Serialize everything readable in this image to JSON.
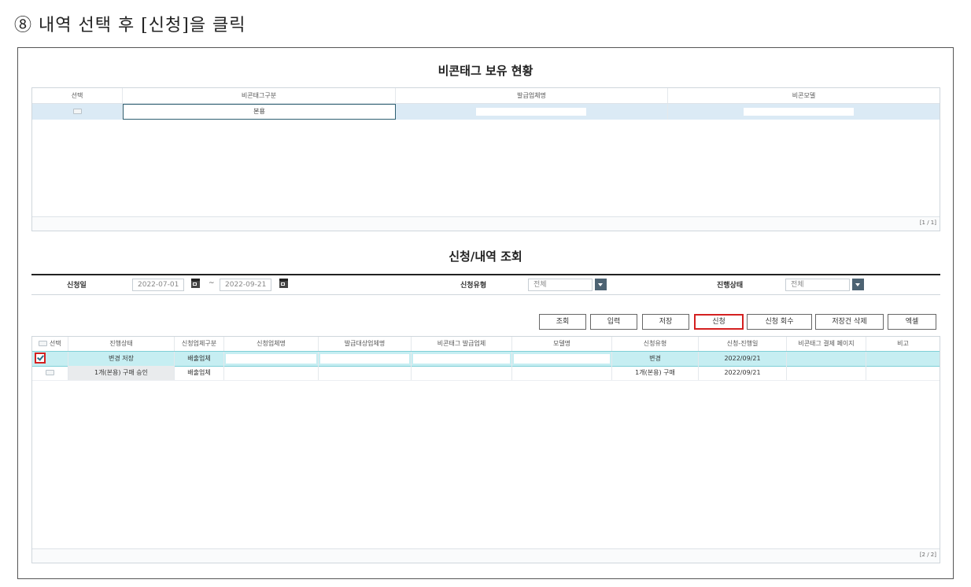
{
  "caption": "⑧ 내역 선택 후 [신청]을 클릭",
  "holdings": {
    "title": "비콘태그 보유 현황",
    "columns": [
      "선택",
      "비콘태그구분",
      "발급업체명",
      "비콘모델"
    ],
    "row": {
      "type": "본용"
    },
    "pager": "[1 / 1]"
  },
  "search": {
    "title": "신청/내역 조회",
    "date_label": "신청일",
    "date_from": "2022-07-01",
    "date_sep": "~",
    "date_to": "2022-09-21",
    "type_label": "신청유형",
    "type_value": "전체",
    "status_label": "진행상태",
    "status_value": "전체"
  },
  "buttons": {
    "query": "조회",
    "input": "입력",
    "save": "저장",
    "apply": "신청",
    "withdraw": "신청 회수",
    "delete_before_save": "저장건 삭제",
    "excel": "엑셀"
  },
  "list": {
    "columns": [
      "선택",
      "진행상태",
      "신청업체구분",
      "신청업체명",
      "발급대상업체명",
      "비콘태그 발급업체",
      "모델명",
      "신청유형",
      "신청-진행일",
      "비콘태그 결제 페이지",
      "비고"
    ],
    "rows": [
      {
        "status": "변경 저장",
        "company_type": "배출업체",
        "apply_type": "변경",
        "date": "2022/09/21"
      },
      {
        "status": "1개(본용) 구매 승인",
        "company_type": "배출업체",
        "apply_type": "1개(본용) 구매",
        "date": "2022/09/21"
      }
    ],
    "pager": "[2 / 2]"
  },
  "colors": {
    "highlight": "#d42020",
    "selected_row": "#c6eef2",
    "header_line": "#222222"
  }
}
